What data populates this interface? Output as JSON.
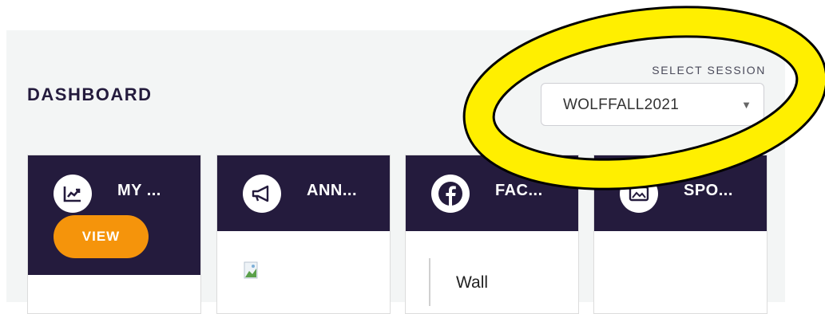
{
  "header": {
    "title": "DASHBOARD"
  },
  "session": {
    "label": "SELECT SESSION",
    "selected": "WOLFFALL2021"
  },
  "cards": [
    {
      "label": "MY ...",
      "icon": "chart-icon",
      "button": "VIEW"
    },
    {
      "label": "ANN...",
      "icon": "megaphone-icon"
    },
    {
      "label": "FAC...",
      "icon": "facebook-icon",
      "body_text": "Wall"
    },
    {
      "label": "SPO...",
      "icon": "image-icon"
    }
  ],
  "colors": {
    "header": "#241b3d",
    "accent": "#f5940b",
    "highlight": "#ffef00",
    "panel": "#f3f5f5"
  }
}
